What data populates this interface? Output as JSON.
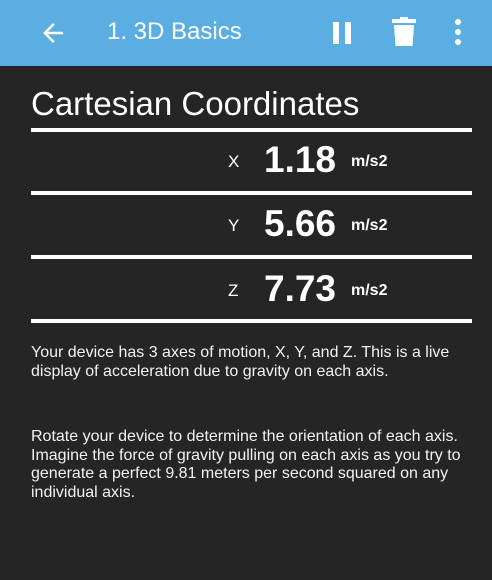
{
  "app_bar": {
    "background": "#5aaee2",
    "title": "1. 3D Basics",
    "back_icon": "arrow-back-icon",
    "pause_icon": "pause-icon",
    "delete_icon": "trash-icon",
    "menu_icon": "more-vert-icon"
  },
  "heading": "Cartesian Coordinates",
  "readings": [
    {
      "axis": "X",
      "value": "1.18",
      "unit": "m/s2"
    },
    {
      "axis": "Y",
      "value": "5.66",
      "unit": "m/s2"
    },
    {
      "axis": "Z",
      "value": "7.73",
      "unit": "m/s2"
    }
  ],
  "paragraphs": [
    "Your device has 3 axes of motion, X, Y, and Z.  This is a live display of acceleration due to gravity on each axis.",
    "Rotate your device to determine the orientation of each axis.  Imagine the force of gravity pulling on each axis as you try to generate a perfect 9.81 meters per second squared on any individual axis."
  ],
  "colors": {
    "background": "#252525",
    "text": "#ffffff"
  }
}
